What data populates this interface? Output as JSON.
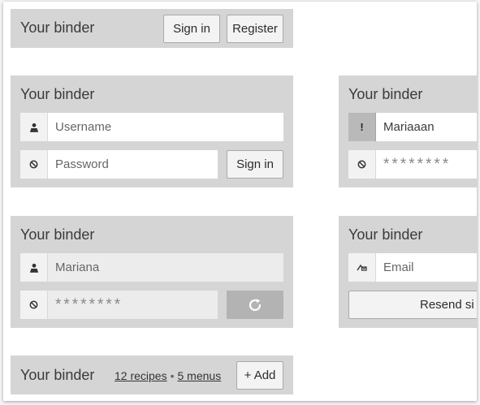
{
  "panel_header": {
    "title": "Your binder",
    "signin_label": "Sign in",
    "register_label": "Register"
  },
  "panel_login": {
    "title": "Your binder",
    "username_placeholder": "Username",
    "password_placeholder": "Password",
    "signin_label": "Sign in"
  },
  "panel_error": {
    "title": "Your binder",
    "error_icon_glyph": "!",
    "username_value": "Mariaaan",
    "password_mask": "********"
  },
  "panel_loading": {
    "title": "Your binder",
    "username_value": "Mariana",
    "password_mask": "********"
  },
  "panel_reset": {
    "title": "Your binder",
    "email_placeholder": "Email",
    "resend_label": "Resend si"
  },
  "panel_loggedin": {
    "title": "Your binder",
    "recipes_link": "12 recipes",
    "separator": "•",
    "menus_link": "5 menus",
    "add_label": "+ Add"
  },
  "icons": {
    "user": "user-icon",
    "lock": "lock-icon",
    "warning": "warning-icon",
    "email": "email-icon",
    "refresh": "refresh-icon"
  },
  "colors": {
    "panel_bg": "#d5d5d5",
    "button_bg": "#f3f3f3",
    "disabled_button": "#b3b3b3",
    "warning_bg": "#b9b9b9"
  }
}
